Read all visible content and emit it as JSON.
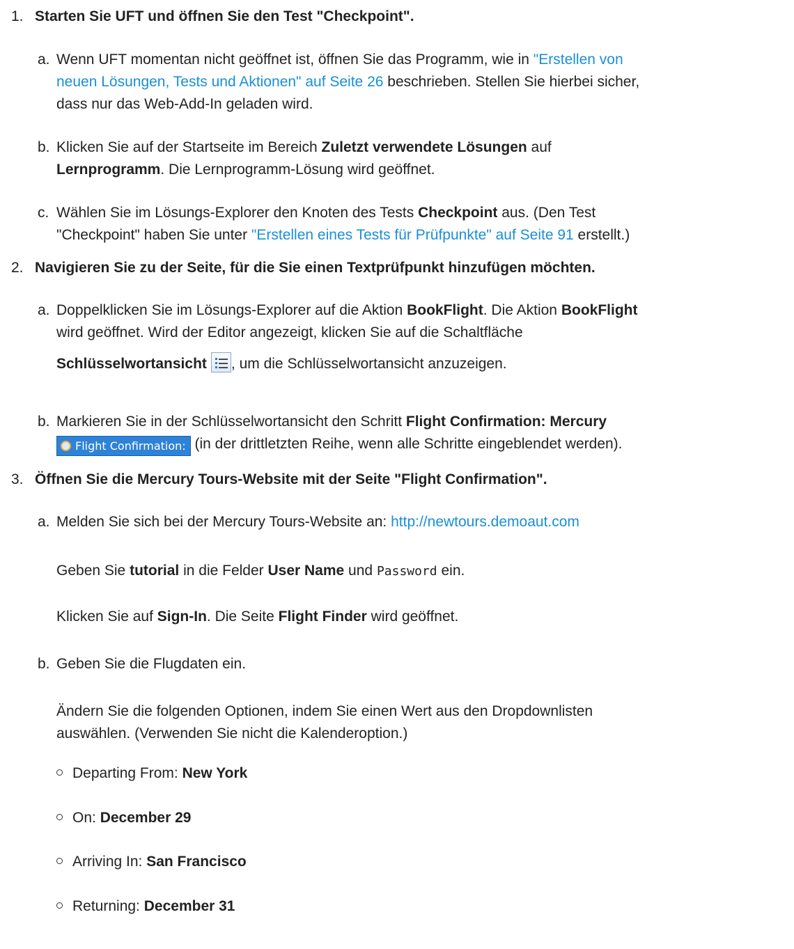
{
  "step1": {
    "number": "1.",
    "heading": "Starten Sie UFT und öffnen Sie den Test \"Checkpoint\".",
    "a": {
      "letter": "a.",
      "t1": "Wenn UFT momentan nicht geöffnet ist, öffnen Sie das Programm, wie in ",
      "link1": "\"Erstellen von",
      "link2": "neuen Lösungen, Tests und Aktionen\" auf Seite 26",
      "t2": " beschrieben. Stellen Sie hierbei sicher,",
      "t3": "dass nur das Web-Add-In geladen wird."
    },
    "b": {
      "letter": "b.",
      "t1": "Klicken Sie auf der Startseite im Bereich ",
      "b1": "Zuletzt verwendete Lösungen",
      "t2": " auf",
      "b2": "Lernprogramm",
      "t3": ". Die Lernprogramm-Lösung wird geöffnet."
    },
    "c": {
      "letter": "c.",
      "t1": "Wählen Sie im Lösungs-Explorer den Knoten des Tests ",
      "b1": "Checkpoint",
      "t2": " aus. (Den Test",
      "t3": "\"Checkpoint\" haben Sie unter ",
      "link": "\"Erstellen eines Tests für Prüfpunkte\" auf Seite 91",
      "t4": " erstellt.)"
    }
  },
  "step2": {
    "number": "2.",
    "heading": "Navigieren Sie zu der Seite, für die Sie einen Textprüfpunkt hinzufügen möchten.",
    "a": {
      "letter": "a.",
      "t1": "Doppelklicken Sie im Lösungs-Explorer auf die Aktion ",
      "b1": "BookFlight",
      "t2": ". Die Aktion ",
      "b2": "BookFlight",
      "t3": "wird geöffnet. Wird der Editor angezeigt, klicken Sie auf die Schaltfläche",
      "b3": "Schlüsselwortansicht",
      "t4": ", um die Schlüsselwortansicht anzuzeigen."
    },
    "b": {
      "letter": "b.",
      "t1": "Markieren Sie in der Schlüsselwortansicht den Schritt ",
      "b1": "Flight Confirmation: Mercury",
      "chip": "Flight Confirmation:",
      "t2": " (in der drittletzten Reihe, wenn alle Schritte eingeblendet werden)."
    }
  },
  "step3": {
    "number": "3.",
    "heading": "Öffnen Sie die Mercury Tours-Website mit der Seite \"Flight Confirmation\".",
    "a": {
      "letter": "a.",
      "t1": "Melden Sie sich bei der Mercury Tours-Website an: ",
      "link": "http://newtours.demoaut.com",
      "p1_t1": "Geben Sie ",
      "p1_b1": "tutorial",
      "p1_t2": " in die Felder ",
      "p1_b2": "User Name",
      "p1_t3": " und ",
      "p1_mono": "Password",
      "p1_t4": " ein.",
      "p2_t1": "Klicken Sie auf ",
      "p2_b1": "Sign-In",
      "p2_t2": ". Die Seite ",
      "p2_b2": "Flight Finder",
      "p2_t3": " wird geöffnet."
    },
    "b": {
      "letter": "b.",
      "t1": "Geben Sie die Flugdaten ein.",
      "p1_l1": "Ändern Sie die folgenden Optionen, indem Sie einen Wert aus den Dropdownlisten",
      "p1_l2": "auswählen. (Verwenden Sie nicht die Kalenderoption.)",
      "bullets": [
        {
          "label": "Departing From: ",
          "value": "New York"
        },
        {
          "label": "On: ",
          "value": "December 29"
        },
        {
          "label": "Arriving In: ",
          "value": "San Francisco"
        },
        {
          "label": "Returning: ",
          "value": "December 31"
        }
      ]
    }
  },
  "icons": {
    "keyword_view": "keyword-view-list-icon",
    "page_object": "page-object-icon"
  }
}
